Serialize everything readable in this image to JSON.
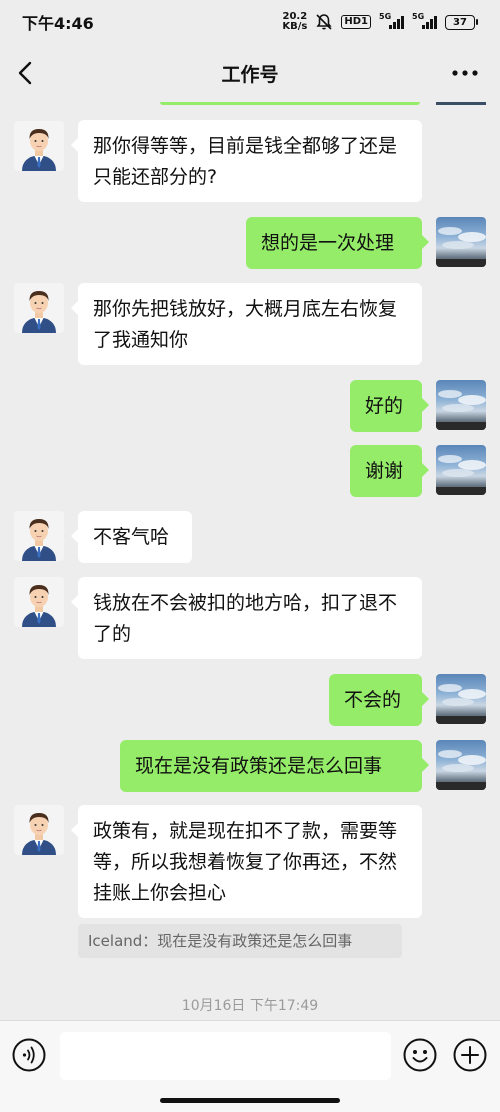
{
  "status_bar": {
    "time": "下午4:46",
    "net_speed_value": "20.2",
    "net_speed_unit": "KB/s",
    "hd_badge": "HD1",
    "signal1_label": "5G",
    "signal2_label": "5G",
    "battery": "37"
  },
  "header": {
    "title": "工作号",
    "back_icon": "chevron-left-icon",
    "more_icon": "more-dots-icon"
  },
  "messages": [
    {
      "side": "in",
      "text": "那你得等等，目前是钱全都够了还是只能还部分的?"
    },
    {
      "side": "out",
      "text": "想的是一次处理"
    },
    {
      "side": "in",
      "text": "那你先把钱放好，大概月底左右恢复了我通知你"
    },
    {
      "side": "out",
      "text": "好的"
    },
    {
      "side": "out",
      "text": "谢谢"
    },
    {
      "side": "in",
      "text": "不客气哈"
    },
    {
      "side": "in",
      "text": "钱放在不会被扣的地方哈，扣了退不了的"
    },
    {
      "side": "out",
      "text": "不会的"
    },
    {
      "side": "out",
      "text": "现在是没有政策还是怎么回事"
    },
    {
      "side": "in",
      "text": "政策有，就是现在扣不了款，需要等等，所以我想着恢复了你再还，不然挂账上你会担心"
    }
  ],
  "quote": {
    "text": "Iceland：现在是没有政策还是怎么回事"
  },
  "timestamp": "10月16日 下午17:49",
  "input_bar": {
    "voice_icon": "voice-icon",
    "emoji_icon": "emoji-icon",
    "plus_icon": "plus-icon"
  },
  "colors": {
    "background": "#ededed",
    "outgoing_bubble": "#95ec69",
    "incoming_bubble": "#ffffff"
  }
}
